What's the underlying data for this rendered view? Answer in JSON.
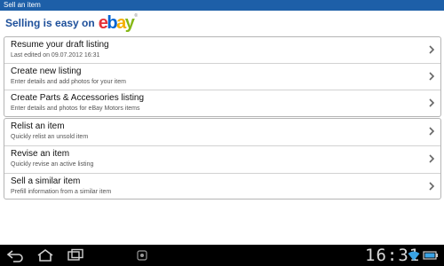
{
  "window": {
    "title": "Sell an item"
  },
  "header": {
    "heading": "Selling is easy on",
    "logo_letters": [
      {
        "char": "e",
        "color": "#e53238"
      },
      {
        "char": "b",
        "color": "#0064d2"
      },
      {
        "char": "a",
        "color": "#f5af02"
      },
      {
        "char": "y",
        "color": "#86b817"
      }
    ]
  },
  "groups": [
    {
      "items": [
        {
          "title": "Resume your draft listing",
          "subtitle": "Last edited on 09.07.2012 16:31"
        },
        {
          "title": "Create new listing",
          "subtitle": "Enter details and add photos for your item"
        },
        {
          "title": "Create Parts & Accessories listing",
          "subtitle": "Enter details and photos for eBay Motors items"
        }
      ]
    },
    {
      "items": [
        {
          "title": "Relist an item",
          "subtitle": "Quickly relist an unsold item"
        },
        {
          "title": "Revise an item",
          "subtitle": "Quickly revise an active listing"
        },
        {
          "title": "Sell a similar item",
          "subtitle": "Prefill information from a similar item"
        }
      ]
    }
  ],
  "status_bar": {
    "time": "16:31"
  },
  "colors": {
    "title_bar": "#1d5fa8",
    "heading": "#1d4f9a"
  }
}
